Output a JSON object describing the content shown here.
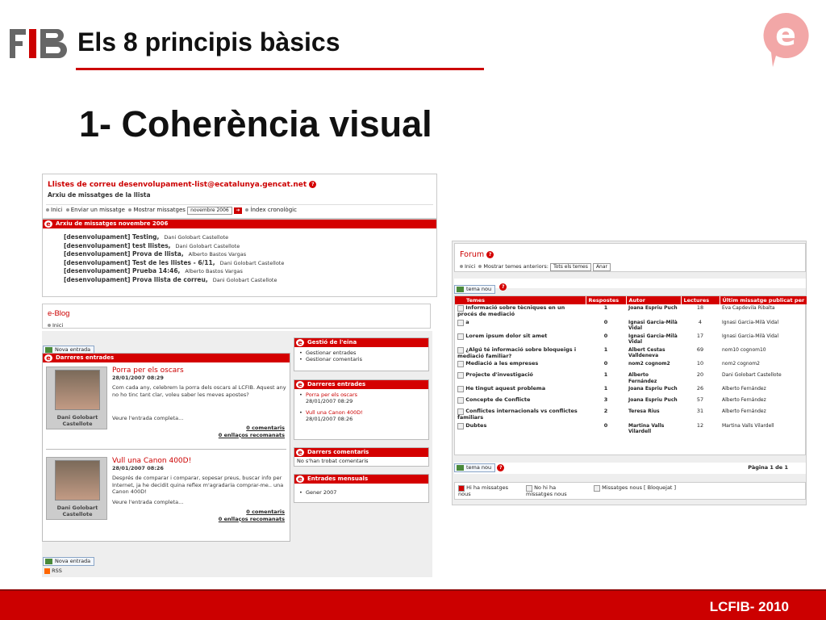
{
  "header": {
    "title": "Els 8 principis bàsics",
    "heading": "1- Coherència visual",
    "logo_fib": "FIB",
    "logo_e": "e"
  },
  "footer": {
    "text": "LCFIB- 2010"
  },
  "colors": {
    "accent": "#cc0000",
    "bar_red": "#d40000"
  },
  "mailing_list": {
    "title": "Llistes de correu desenvolupament-list@ecatalunya.gencat.net",
    "subtitle": "Arxiu de missatges de la llista",
    "nav": {
      "home": "Inici",
      "send": "Enviar un missatge",
      "show": "Mostrar missatges",
      "month": "novembre 2006",
      "index": "Índex cronològic"
    },
    "archive_title": "Arxiu de missatges novembre 2006",
    "messages": [
      {
        "subject": "[desenvolupament] Testing,",
        "author": "Dani Golobart Castellote"
      },
      {
        "subject": "[desenvolupament] test llistes,",
        "author": "Dani Golobart Castellote"
      },
      {
        "subject": "[desenvolupament] Prova de llista,",
        "author": "Alberto Bastos Vargas"
      },
      {
        "subject": "[desenvolupament] Test de les llistes - 6/11,",
        "author": "Dani Golobart Castellote"
      },
      {
        "subject": "[desenvolupament] Prueba 14:46,",
        "author": "Alberto Bastos Vargas"
      },
      {
        "subject": "[desenvolupament] Prova llista de correu,",
        "author": "Dani Golobart Castellote"
      }
    ]
  },
  "blog": {
    "title": "e-Blog",
    "nav_home": "Inici",
    "new_entry": "Nova entrada",
    "latest_title": "Darreres entrades",
    "posts": [
      {
        "title": "Porra per els oscars",
        "date": "28/01/2007 08:29",
        "text": "Com cada any, celebrem la porra dels oscars al LCFIB. Aquest any no ho tinc tant clar, voleu saber les meves apostes?",
        "more": "Veure l'entrada completa...",
        "comments": "0 comentaris",
        "links": "0 enllaços recomanats",
        "author": "Dani Golobart Castellote"
      },
      {
        "title": "Vull una Canon 400D!",
        "date": "28/01/2007 08:26",
        "text": "Després de comparar i comparar, sopesar preus, buscar info per Internet, ja he decidit quina reflex m'agradaria comprar-me.. una Canon 400D!",
        "more": "Veure l'entrada completa...",
        "comments": "0 comentaris",
        "links": "0 enllaços recomanats",
        "author": "Dani Golobart Castellote"
      }
    ],
    "manage": {
      "title": "Gestió de l'eina",
      "items": [
        "Gestionar entrades",
        "Gestionar comentaris"
      ]
    },
    "side_latest": {
      "title": "Darreres entrades",
      "items": [
        {
          "t": "Porra per els oscars",
          "d": "28/01/2007 08:29"
        },
        {
          "t": "Vull una Canon 400D!",
          "d": "28/01/2007 08:26"
        }
      ]
    },
    "comments": {
      "title": "Darrers comentaris",
      "empty": "No s'han trobat comentaris"
    },
    "monthly": {
      "title": "Entrades mensuals",
      "items": [
        "Gener 2007"
      ]
    },
    "rss": "RSS"
  },
  "forum": {
    "title": "Forum",
    "home": "Inici",
    "show_prev": "Mostrar temes anteriors:",
    "select": "Tots els temes",
    "go": "Anar",
    "new_topic": "tema nou",
    "columns": [
      "Temes",
      "Respostes",
      "Autor",
      "Lectures",
      "Últim missatge publicat per"
    ],
    "rows": [
      {
        "topic": "Informació sobre tècniques en un procés de mediació",
        "replies": "1",
        "author": "Joana Espriu Puch",
        "reads": "18",
        "last": "Eva Capdevila Ribalta"
      },
      {
        "topic": "a",
        "replies": "0",
        "author": "Ignasi Garcia-Milà Vidal",
        "reads": "4",
        "last": "Ignasi Garcia-Milà Vidal"
      },
      {
        "topic": "Lorem ipsum dolor sit amet",
        "replies": "0",
        "author": "Ignasi Garcia-Milà Vidal",
        "reads": "17",
        "last": "Ignasi Garcia-Milà Vidal"
      },
      {
        "topic": "¿Algú té informació sobre bloqueigs i mediació familiar?",
        "replies": "1",
        "author": "Albert Cestas Valldeneva",
        "reads": "69",
        "last": "nom10 cognom10"
      },
      {
        "topic": "Mediació a les empreses",
        "replies": "0",
        "author": "nom2 cognom2",
        "reads": "10",
        "last": "nom2 cognom2"
      },
      {
        "topic": "Projecte d'investigació",
        "replies": "1",
        "author": "Alberto Fernández",
        "reads": "20",
        "last": "Dani Golobart Castellote"
      },
      {
        "topic": "He tingut aquest problema",
        "replies": "1",
        "author": "Joana Espriu Puch",
        "reads": "26",
        "last": "Alberto Fernández"
      },
      {
        "topic": "Concepte de Conflicte",
        "replies": "3",
        "author": "Joana Espriu Puch",
        "reads": "57",
        "last": "Alberto Fernández"
      },
      {
        "topic": "Conflictes internacionals vs conflictes familiars",
        "replies": "2",
        "author": "Teresa Rius",
        "reads": "31",
        "last": "Alberto Fernández"
      },
      {
        "topic": "Dubtes",
        "replies": "0",
        "author": "Martina Valls Vilardell",
        "reads": "12",
        "last": "Martina Valls Vilardell"
      }
    ],
    "page": "Pàgina 1 de 1",
    "legend": [
      "Hi ha missatges nous",
      "No hi ha missatges nous",
      "Missatges nous [ Bloquejat ]"
    ]
  }
}
